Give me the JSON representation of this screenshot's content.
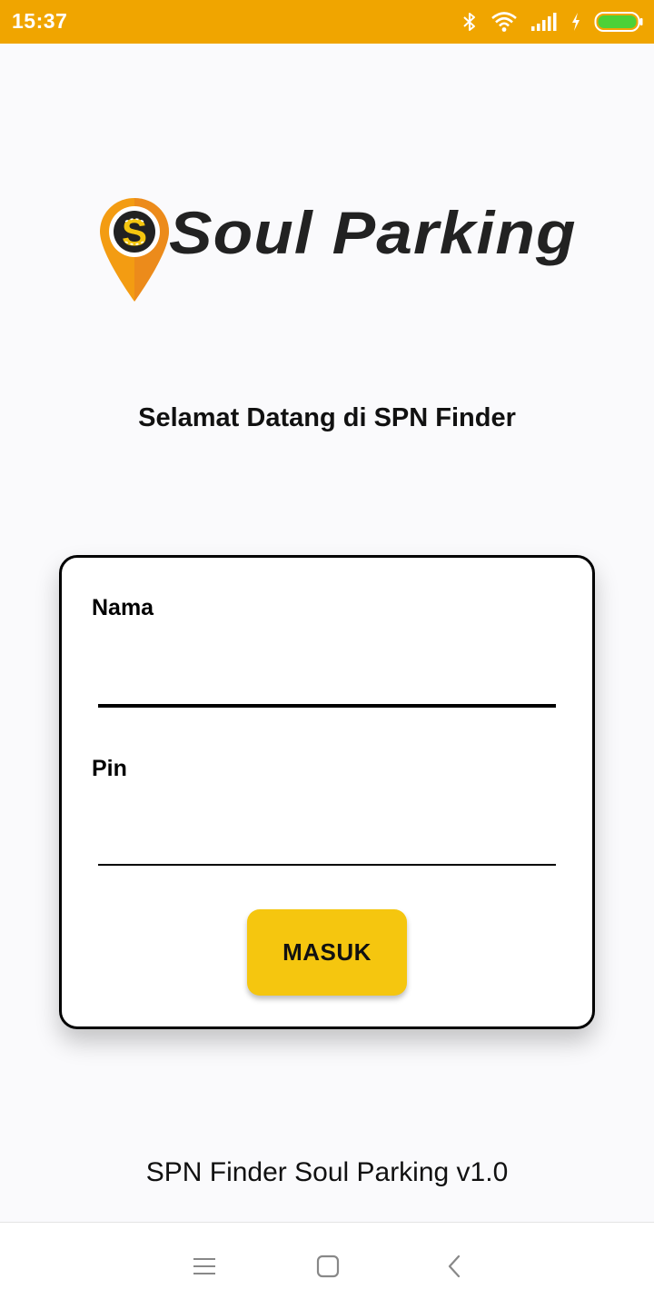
{
  "status_bar": {
    "time": "15:37",
    "icons": [
      "bluetooth-icon",
      "wifi-icon",
      "signal-icon",
      "charging-icon",
      "battery-icon"
    ],
    "background_color": "#f0a500",
    "battery_color": "#4cd137"
  },
  "logo": {
    "text": "Soul Parking",
    "pin_color": "#f39c12"
  },
  "welcome": {
    "text": "Selamat Datang di SPN Finder"
  },
  "login": {
    "name_label": "Nama",
    "name_value": "",
    "pin_label": "Pin",
    "pin_value": "",
    "submit_label": "MASUK",
    "button_color": "#f5c60f"
  },
  "footer": {
    "version_text": "SPN Finder Soul Parking v1.0"
  },
  "nav_bar": {
    "buttons": [
      "menu-icon",
      "home-icon",
      "back-icon"
    ]
  }
}
